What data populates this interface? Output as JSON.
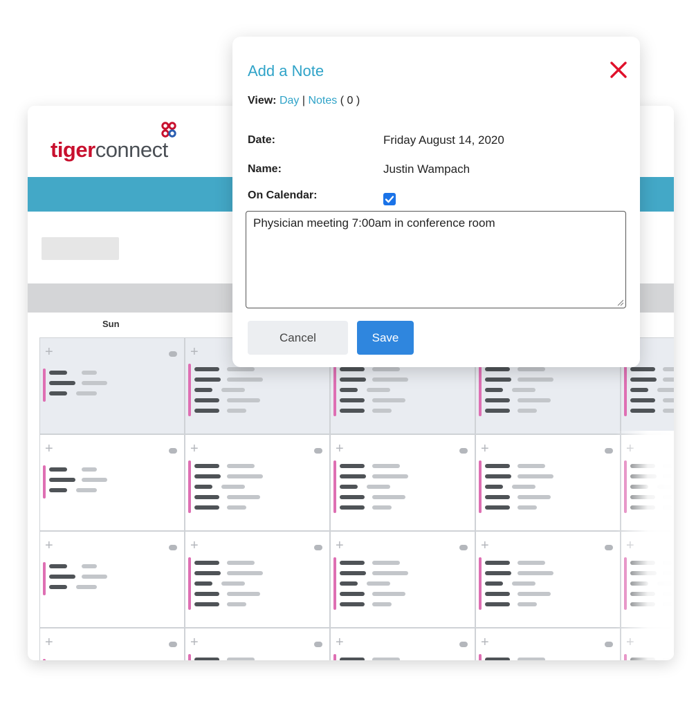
{
  "logo": {
    "part1": "tiger",
    "part2": "connect"
  },
  "calendar": {
    "day_headers": [
      "Sun"
    ],
    "add_icon": "plus-icon",
    "more_icon": "ellipsis-dot-icon"
  },
  "modal": {
    "title": "Add a Note",
    "view_label": "View:",
    "view_day": "Day",
    "view_sep": "|",
    "view_notes": "Notes",
    "notes_count": "( 0 )",
    "date_label": "Date:",
    "date_value": "Friday August 14, 2020",
    "name_label": "Name:",
    "name_value": "Justin Wampach",
    "on_calendar_label": "On Calendar:",
    "on_calendar_checked": true,
    "note_text": "Physician meeting 7:00am in conference room",
    "cancel_label": "Cancel",
    "save_label": "Save",
    "close_icon": "close-icon"
  },
  "colors": {
    "brand_teal": "#43a8c7",
    "title_blue": "#2fa3c8",
    "logo_red": "#c8102e",
    "save_blue": "#2f86de",
    "event_pink": "#de6fb3",
    "close_red": "#e0102a"
  }
}
